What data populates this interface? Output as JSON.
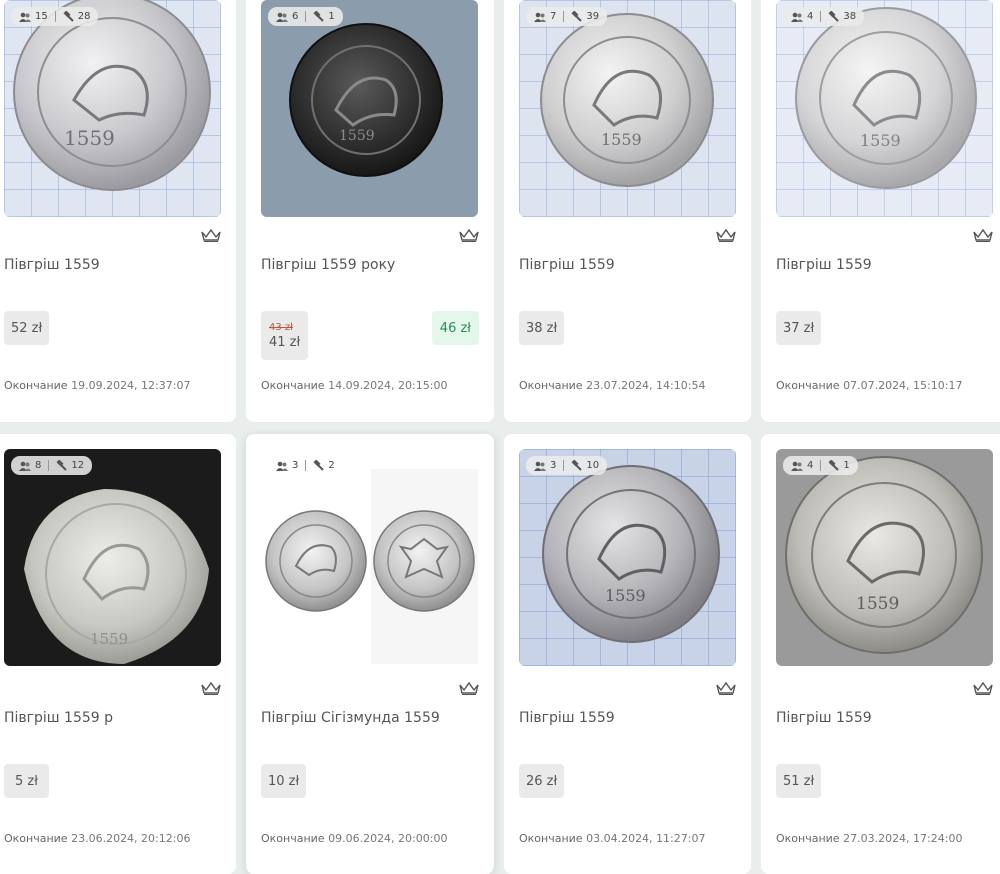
{
  "listings": [
    {
      "users": "15",
      "bids": "28",
      "title": "Півгріш 1559",
      "price": "52 zł",
      "ends_label": "Окончание",
      "ends_date": "19.09.2024, 12:37:07"
    },
    {
      "users": "6",
      "bids": "1",
      "title": "Півгріш 1559 року",
      "old_price": "43 zł",
      "price": "41 zł",
      "bid_price": "46 zł",
      "ends_label": "Окончание",
      "ends_date": "14.09.2024, 20:15:00"
    },
    {
      "users": "7",
      "bids": "39",
      "title": "Півгріш 1559",
      "price": "38 zł",
      "ends_label": "Окончание",
      "ends_date": "23.07.2024, 14:10:54"
    },
    {
      "users": "4",
      "bids": "38",
      "title": "Півгріш 1559",
      "price": "37 zł",
      "ends_label": "Окончание",
      "ends_date": "07.07.2024, 15:10:17"
    },
    {
      "users": "8",
      "bids": "12",
      "title": "Півгріш 1559 р",
      "price": "5 zł",
      "ends_label": "Окончание",
      "ends_date": "23.06.2024, 20:12:06"
    },
    {
      "users": "3",
      "bids": "2",
      "title": "Півгріш Сігізмунда 1559",
      "price": "10 zł",
      "ends_label": "Окончание",
      "ends_date": "09.06.2024, 20:00:00"
    },
    {
      "users": "3",
      "bids": "10",
      "title": "Півгріш 1559",
      "price": "26 zł",
      "ends_label": "Окончание",
      "ends_date": "03.04.2024, 11:27:07"
    },
    {
      "users": "4",
      "bids": "1",
      "title": "Півгріш 1559",
      "price": "51 zł",
      "ends_label": "Окончание",
      "ends_date": "27.03.2024, 17:24:00"
    }
  ],
  "icons": {
    "users": "users-icon",
    "bids": "hammer-icon",
    "favorite": "crown-icon",
    "next": "chevron-right-icon"
  },
  "colors": {
    "old_price": "#c0563e",
    "bid_price": "#2e8b57",
    "bid_bg": "#e3f7ea",
    "price_bg": "#eaeaea"
  }
}
